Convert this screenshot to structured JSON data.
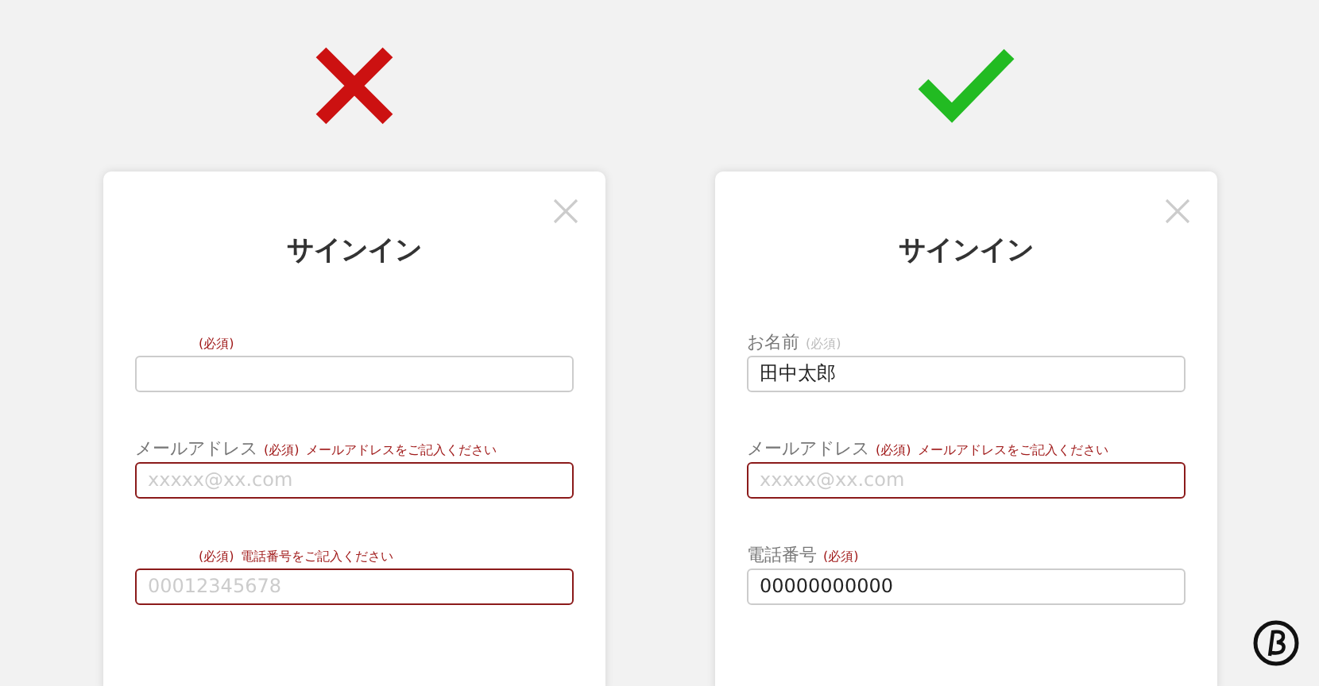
{
  "panels": [
    {
      "correct": false,
      "dialog": {
        "title": "サインイン",
        "fields": [
          {
            "required": "(必須)",
            "required_error": true,
            "error": false
          },
          {
            "label": "メールアドレス",
            "required": "(必須)",
            "required_error": true,
            "message": "メールアドレスをご記入ください",
            "input": {
              "placeholder": "xxxxx@xx.com"
            },
            "error": true
          },
          {
            "required": "(必須)",
            "required_error": true,
            "message": "電話番号をご記入ください",
            "input": {
              "placeholder": "00012345678"
            },
            "error": true
          }
        ]
      }
    },
    {
      "correct": true,
      "dialog": {
        "title": "サインイン",
        "fields": [
          {
            "label": "お名前",
            "required": "(必須)",
            "required_error": false,
            "input": {
              "value": "田中太郎"
            },
            "error": false
          },
          {
            "label": "メールアドレス",
            "required": "(必須)",
            "required_error": true,
            "message": "メールアドレスをご記入ください",
            "input": {
              "placeholder": "xxxxx@xx.com"
            },
            "error": true
          },
          {
            "label": "電話番号",
            "required": "(必須)",
            "required_error": true,
            "input": {
              "value": "00000000000"
            },
            "error": false
          }
        ]
      }
    }
  ]
}
